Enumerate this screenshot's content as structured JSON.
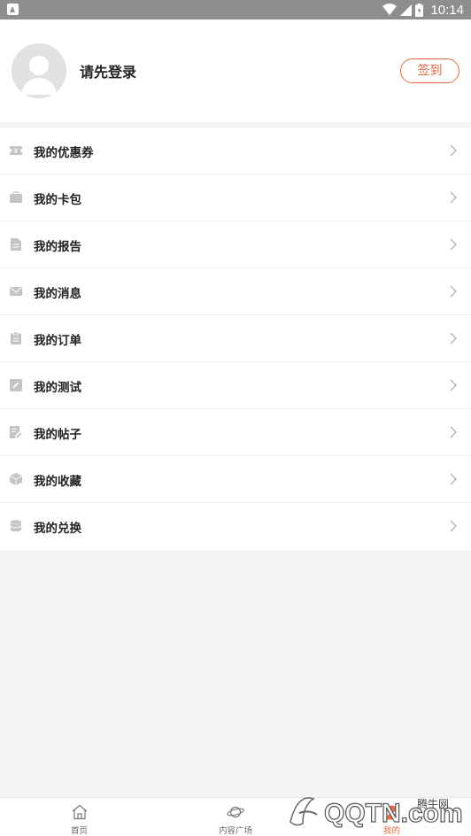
{
  "status_bar": {
    "time": "10:14",
    "icons": [
      "app-notification-icon",
      "wifi-icon",
      "signal-icon",
      "battery-icon"
    ]
  },
  "profile": {
    "login_prompt": "请先登录",
    "signin_label": "签到"
  },
  "menu": {
    "items": [
      {
        "label": "我的优惠券",
        "icon": "coupon-icon"
      },
      {
        "label": "我的卡包",
        "icon": "wallet-icon"
      },
      {
        "label": "我的报告",
        "icon": "report-icon"
      },
      {
        "label": "我的消息",
        "icon": "message-icon"
      },
      {
        "label": "我的订单",
        "icon": "order-icon"
      },
      {
        "label": "我的测试",
        "icon": "test-icon"
      },
      {
        "label": "我的帖子",
        "icon": "post-icon"
      },
      {
        "label": "我的收藏",
        "icon": "favorite-icon"
      },
      {
        "label": "我的兑换",
        "icon": "exchange-icon"
      }
    ]
  },
  "bottom_nav": {
    "items": [
      {
        "label": "首页",
        "icon": "home-icon"
      },
      {
        "label": "内容广场",
        "icon": "planet-icon"
      },
      {
        "label": "我的",
        "icon": "profile-icon"
      }
    ]
  },
  "watermark": {
    "text": "QQTN.com",
    "site": "腾牛网"
  },
  "colors": {
    "accent": "#e86a3e",
    "status_bar": "#8e8e8e",
    "background": "#f4f4f4",
    "icon_gray": "#c4c4c4"
  }
}
